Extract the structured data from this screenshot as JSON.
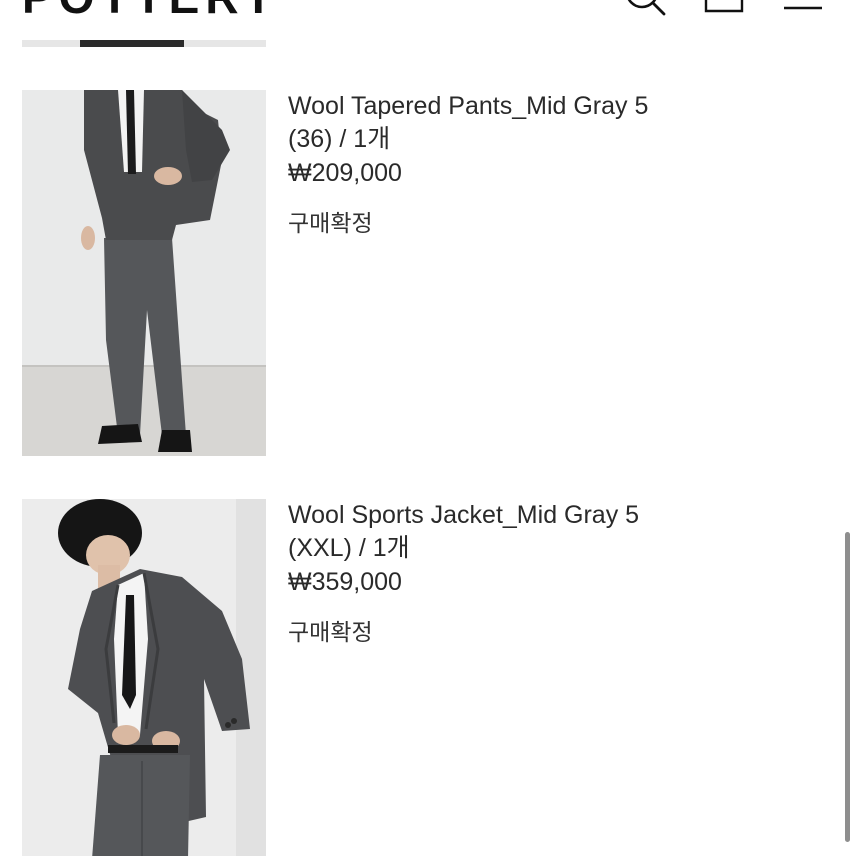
{
  "header": {
    "brand": "POTTERY",
    "icons": {
      "search": "search-icon",
      "cart": "shopping-bag-icon",
      "menu": "hamburger-menu-icon"
    }
  },
  "orders": [
    {
      "image": "wool-tapered-pants-model-photo",
      "name": "Wool Tapered Pants_Mid Gray 5",
      "option": "(36) / 1개",
      "price": "₩209,000",
      "status": "구매확정"
    },
    {
      "image": "wool-sports-jacket-model-photo",
      "name": "Wool Sports Jacket_Mid Gray 5",
      "option": "(XXL) / 1개",
      "price": "₩359,000",
      "status": "구매확정"
    }
  ],
  "colors": {
    "text": "#2a2a2a",
    "suit": "#4a4b4d",
    "background": "#ffffff"
  }
}
